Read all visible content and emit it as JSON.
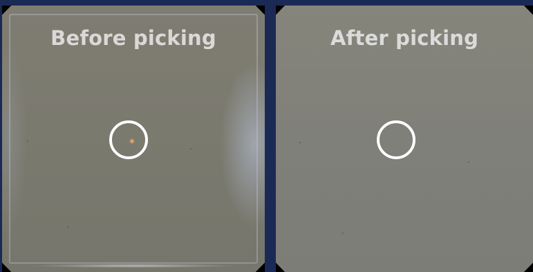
{
  "panels": [
    {
      "title": "Before picking",
      "marker": "target-circle",
      "particle_visible": true
    },
    {
      "title": "After picking",
      "marker": "target-circle",
      "particle_visible": false
    }
  ],
  "colors": {
    "background": "#1b2a55",
    "marker": "#ffffff",
    "particle": "#f2a35e",
    "title": "#eeeeee"
  }
}
